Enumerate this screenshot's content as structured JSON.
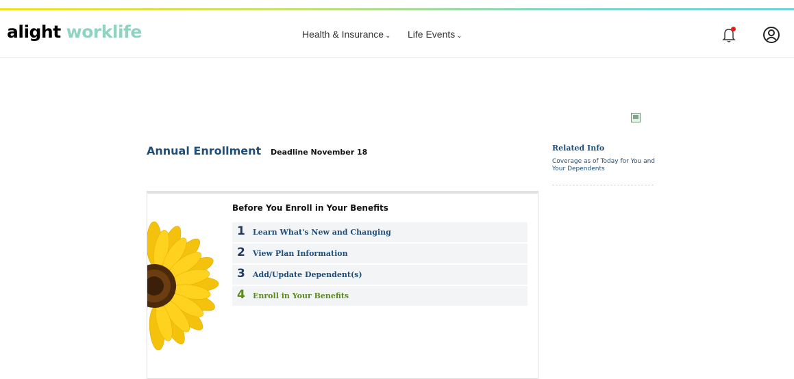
{
  "header": {
    "logo_primary": "alight",
    "logo_secondary": "worklife",
    "nav": [
      {
        "label": "Health & Insurance",
        "chevron": "⌄"
      },
      {
        "label": "Life Events",
        "chevron": "⌄"
      }
    ],
    "icons": {
      "notifications": "bell-icon",
      "profile": "user-circle-icon"
    }
  },
  "page": {
    "title": "Annual Enrollment",
    "deadline": "Deadline November 18"
  },
  "related": {
    "heading": "Related Info",
    "link": "Coverage as of Today for You and Your Dependents"
  },
  "panel": {
    "heading": "Before You Enroll in Your Benefits",
    "steps": [
      {
        "num": "1",
        "label": "Learn What's New and Changing"
      },
      {
        "num": "2",
        "label": "View Plan Information"
      },
      {
        "num": "3",
        "label": "Add/Update Dependent(s)"
      },
      {
        "num": "4",
        "label": "Enroll in Your Benefits"
      }
    ]
  },
  "colors": {
    "brand_blue": "#1f4e79",
    "active_green": "#5a8a1e",
    "logo_teal": "#8fd3c0",
    "alert_red": "#e0201b"
  }
}
